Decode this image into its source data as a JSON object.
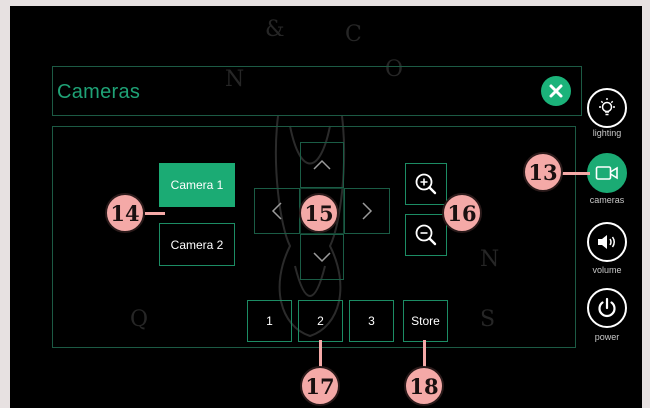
{
  "panel": {
    "title": "Cameras"
  },
  "camera_buttons": [
    {
      "label": "Camera 1",
      "active": true
    },
    {
      "label": "Camera 2",
      "active": false
    }
  ],
  "presets": [
    "1",
    "2",
    "3"
  ],
  "store_label": "Store",
  "sidebar": {
    "lighting": "lighting",
    "cameras": "cameras",
    "volume": "volume",
    "power": "power"
  },
  "callouts": {
    "cameras": "13",
    "camera_select": "14",
    "pan_tilt": "15",
    "zoom": "16",
    "presets": "17",
    "store": "18"
  },
  "colors": {
    "accent": "#1bab74",
    "callout": "#f4a9a7"
  }
}
